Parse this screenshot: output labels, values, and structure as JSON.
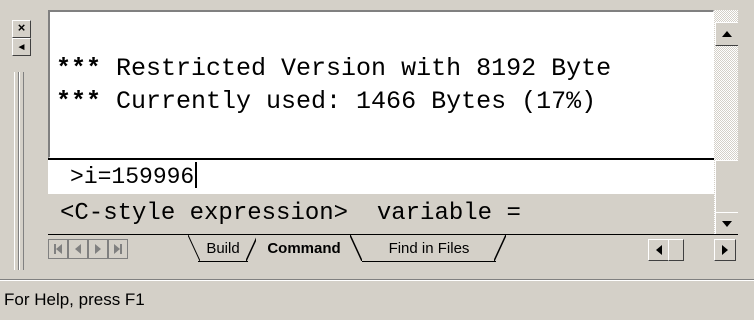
{
  "window": {
    "close_glyph": "×",
    "restore_glyph": "◄"
  },
  "output": {
    "lines": [
      {
        "prefix": "***",
        "text": " Restricted Version with 8192 Byte"
      },
      {
        "prefix": "***",
        "text": " Currently used: 1466 Bytes (17%)"
      }
    ]
  },
  "command": {
    "prompt": ">",
    "value": "i=159996"
  },
  "syntax_hint": "<C-style expression>  variable =",
  "tabs": [
    {
      "label": "Build",
      "active": false
    },
    {
      "label": "Command",
      "active": true
    },
    {
      "label": "Find in Files",
      "active": false
    }
  ],
  "status_bar": {
    "text": "For Help, press F1"
  },
  "icons": {
    "close": "close-icon",
    "dock": "dock-arrow-icon",
    "scroll_up": "scroll-up-icon",
    "scroll_down": "scroll-down-icon",
    "scroll_left": "scroll-left-icon",
    "scroll_right": "scroll-right-icon"
  },
  "colors": {
    "face": "#d4d0c8",
    "window": "#ffffff",
    "text": "#000000",
    "shadow": "#808080"
  }
}
